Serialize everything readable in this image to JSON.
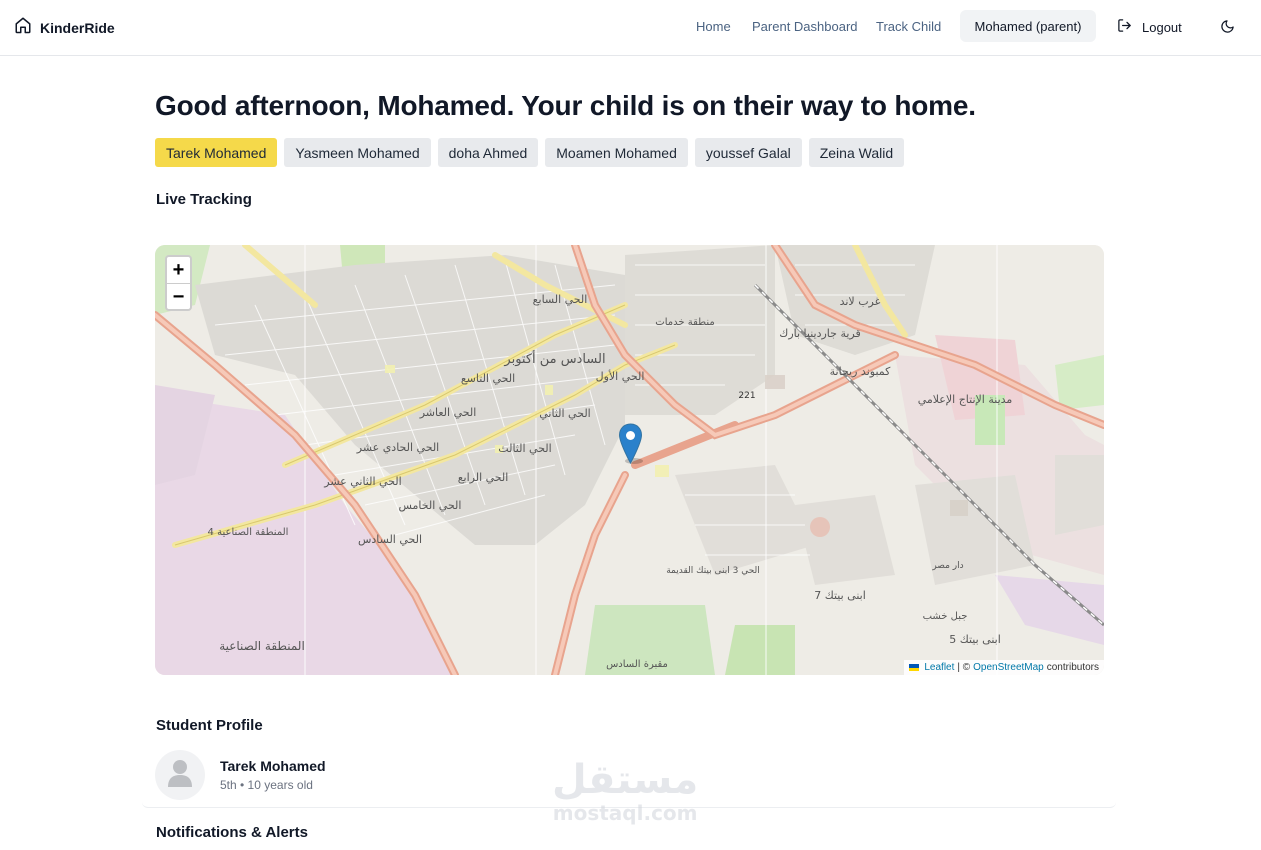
{
  "app": {
    "name": "KinderRide"
  },
  "nav": {
    "links": [
      "Home",
      "Parent Dashboard",
      "Track Child"
    ],
    "user": "Mohamed (parent)",
    "logout": "Logout"
  },
  "greeting": "Good afternoon, Mohamed. Your child is on their way to home.",
  "children": [
    "Tarek Mohamed",
    "Yasmeen Mohamed",
    "doha Ahmed",
    "Moamen Mohamed",
    "youssef Galal",
    "Zeina Walid"
  ],
  "selected_child": "Tarek Mohamed",
  "live_tracking": {
    "title": "Live Tracking",
    "zoom_in": "+",
    "zoom_out": "−",
    "attribution": {
      "leaflet": "Leaflet",
      "sep": "| ©",
      "osm": "OpenStreetMap",
      "suffix": "contributors"
    },
    "map_labels": [
      "الحي السابع",
      "منطقة خدمات",
      "غرب لاند",
      "قرية جاردينيا بارك",
      "السادس من أكتوبر",
      "الحي التاسع",
      "الحي الأول",
      "كمبوند ريحانة",
      "الحي العاشر",
      "الحي الثاني",
      "مدينة الإنتاج الإعلامي",
      "الحي الحادي عشر",
      "الحي الثالث",
      "الحي الثاني عشر",
      "الحي الرابع",
      "الحي الخامس",
      "المنطقة الصناعية 4",
      "الحي السادس",
      "الحي 3 ابنى بيتك القديمة",
      "ابنى بيتك 7",
      "دار مصر",
      "جبل خشب",
      "ابنى بيتك 5",
      "المنطقة الصناعية",
      "مقبرة السادس",
      "221"
    ]
  },
  "student_profile": {
    "title": "Student Profile",
    "name": "Tarek Mohamed",
    "details": "5th • 10 years old"
  },
  "notifications": {
    "title": "Notifications & Alerts"
  },
  "watermark": {
    "arabic": "مستقل",
    "latin": "mostaql.com"
  },
  "colors": {
    "accent_chip": "#f5d94a",
    "chip": "#e8eaed",
    "nav_link": "#4b6382",
    "marker": "#2a81cb"
  }
}
